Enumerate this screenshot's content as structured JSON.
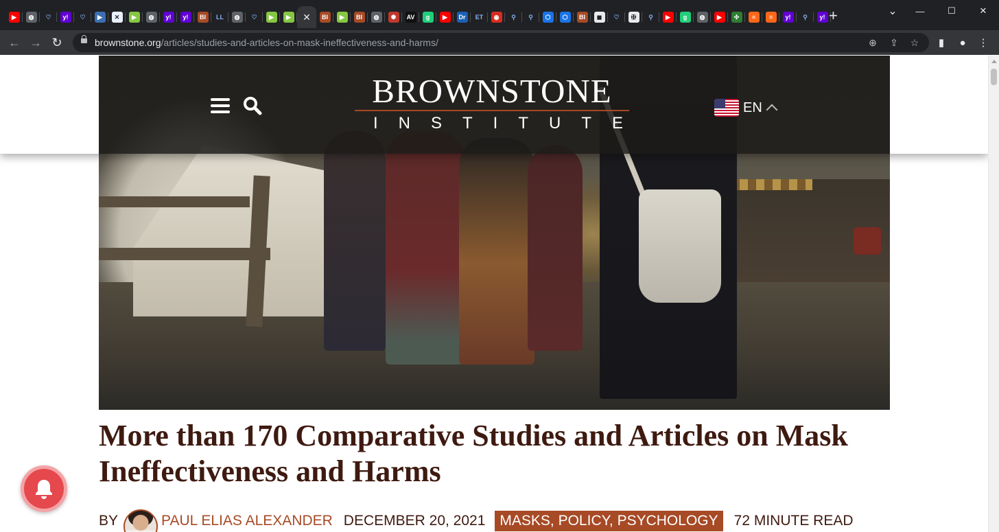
{
  "browser": {
    "tabs": [
      {
        "icon": "youtube-icon",
        "color": "#ff0000",
        "glyph": "▶"
      },
      {
        "icon": "globe-icon",
        "color": "#5f6368",
        "glyph": "◍"
      },
      {
        "icon": "shield-icon",
        "color": "#202124",
        "glyph": "♡"
      },
      {
        "icon": "yahoo-icon",
        "color": "#6001d2",
        "glyph": "y!"
      },
      {
        "icon": "shield-icon",
        "color": "#202124",
        "glyph": "♡"
      },
      {
        "icon": "flag-icon",
        "color": "#3c6fb0",
        "glyph": "▶"
      },
      {
        "icon": "image-icon",
        "color": "#e8f0fe",
        "glyph": "✕"
      },
      {
        "icon": "rumble-icon",
        "color": "#85c742",
        "glyph": "▶"
      },
      {
        "icon": "globe-icon",
        "color": "#5f6368",
        "glyph": "◍"
      },
      {
        "icon": "yahoo-icon",
        "color": "#6001d2",
        "glyph": "y!"
      },
      {
        "icon": "yahoo-icon",
        "color": "#6001d2",
        "glyph": "y!"
      },
      {
        "icon": "brownstone-icon",
        "color": "#a74a26",
        "glyph": "BI"
      },
      {
        "icon": "text-icon",
        "color": "#202124",
        "glyph": "LL"
      },
      {
        "icon": "globe-icon",
        "color": "#5f6368",
        "glyph": "◍"
      },
      {
        "icon": "shield-icon",
        "color": "#202124",
        "glyph": "♡"
      },
      {
        "icon": "rumble-icon",
        "color": "#85c742",
        "glyph": "▶"
      },
      {
        "icon": "rumble-icon",
        "color": "#85c742",
        "glyph": "▶"
      },
      {
        "icon": "close-icon",
        "color": "#35363a",
        "glyph": "✕",
        "active": true
      },
      {
        "icon": "brownstone-icon",
        "color": "#a74a26",
        "glyph": "BI"
      },
      {
        "icon": "rumble-icon",
        "color": "#85c742",
        "glyph": "▶"
      },
      {
        "icon": "brownstone-icon",
        "color": "#a74a26",
        "glyph": "BI"
      },
      {
        "icon": "globe-icon",
        "color": "#5f6368",
        "glyph": "◍"
      },
      {
        "icon": "sunburst-icon",
        "color": "#c0392b",
        "glyph": "✺"
      },
      {
        "icon": "news-icon",
        "color": "#111111",
        "glyph": "AV"
      },
      {
        "icon": "gab-icon",
        "color": "#21cf7a",
        "glyph": "g"
      },
      {
        "icon": "youtube-icon",
        "color": "#ff0000",
        "glyph": "▶"
      },
      {
        "icon": "dr-icon",
        "color": "#1a5fb4",
        "glyph": "Dr"
      },
      {
        "icon": "et-icon",
        "color": "#202124",
        "glyph": "ET"
      },
      {
        "icon": "podcast-icon",
        "color": "#d62d20",
        "glyph": "◉"
      },
      {
        "icon": "search-icon",
        "color": "#202124",
        "glyph": "⚲"
      },
      {
        "icon": "search-icon",
        "color": "#202124",
        "glyph": "⚲"
      },
      {
        "icon": "cube-icon",
        "color": "#1a73e8",
        "glyph": "⬡"
      },
      {
        "icon": "cube-icon",
        "color": "#1a73e8",
        "glyph": "⬡"
      },
      {
        "icon": "brownstone-icon",
        "color": "#a74a26",
        "glyph": "BI"
      },
      {
        "icon": "badge-icon",
        "color": "#e8eaed",
        "glyph": "◼"
      },
      {
        "icon": "shield-icon",
        "color": "#202124",
        "glyph": "♡"
      },
      {
        "icon": "crest-icon",
        "color": "#e8eaed",
        "glyph": "✠"
      },
      {
        "icon": "search-icon",
        "color": "#202124",
        "glyph": "⚲"
      },
      {
        "icon": "youtube-icon",
        "color": "#ff0000",
        "glyph": "▶"
      },
      {
        "icon": "gab-icon",
        "color": "#21cf7a",
        "glyph": "g"
      },
      {
        "icon": "globe-icon",
        "color": "#5f6368",
        "glyph": "◍"
      },
      {
        "icon": "youtube-icon",
        "color": "#ff0000",
        "glyph": "▶"
      },
      {
        "icon": "leaf-icon",
        "color": "#2e7d32",
        "glyph": "✣"
      },
      {
        "icon": "substack-icon",
        "color": "#ff6719",
        "glyph": "≡"
      },
      {
        "icon": "substack-icon",
        "color": "#ff6719",
        "glyph": "≡"
      },
      {
        "icon": "yahoo-icon",
        "color": "#6001d2",
        "glyph": "y!"
      },
      {
        "icon": "search-icon",
        "color": "#202124",
        "glyph": "⚲"
      },
      {
        "icon": "yahoo-icon",
        "color": "#6001d2",
        "glyph": "y!"
      }
    ],
    "new_tab": "+",
    "window": {
      "minimize": "—",
      "maximize": "☐",
      "close": "✕",
      "tab_search": "⌄"
    },
    "nav": {
      "back": "←",
      "forward": "→",
      "reload": "↻"
    },
    "url": {
      "host": "brownstone.org",
      "path": "/articles/studies-and-articles-on-mask-ineffectiveness-and-harms/"
    },
    "omni_icons": {
      "zoom": "⊕",
      "share": "⇪",
      "bookmark": "☆"
    },
    "toolbar_icons": {
      "side_panel": "▮",
      "profile": "●",
      "menu": "⋮"
    }
  },
  "site": {
    "logo_main": "BROWNSTONE",
    "logo_sub": "INSTITUTE",
    "language": "EN",
    "brand_color": "#a74a26"
  },
  "article": {
    "title": "More than 170 Comparative Studies and Articles on Mask Ineffectiveness and Harms",
    "by": "BY",
    "author": "PAUL ELIAS ALEXANDER",
    "date": "DECEMBER 20, 2021",
    "categories": "MASKS, POLICY, PSYCHOLOGY",
    "read_time": "72 MINUTE READ",
    "text_color": "#3e1a10"
  },
  "notification": {
    "color": "#e5484d"
  }
}
